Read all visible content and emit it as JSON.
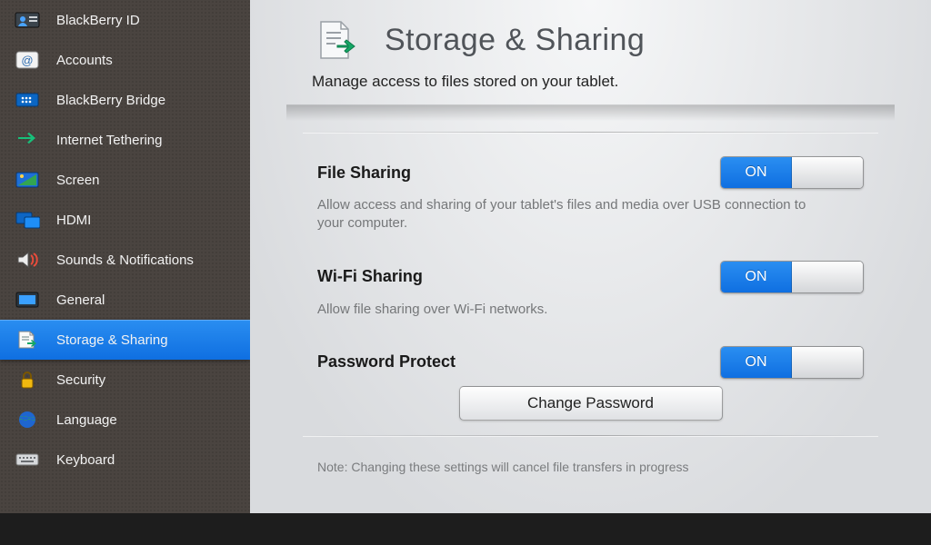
{
  "sidebar": {
    "items": [
      {
        "label": "BlackBerry ID",
        "icon": "bbid"
      },
      {
        "label": "Accounts",
        "icon": "at"
      },
      {
        "label": "BlackBerry Bridge",
        "icon": "bridge"
      },
      {
        "label": "Internet Tethering",
        "icon": "tether"
      },
      {
        "label": "Screen",
        "icon": "screen"
      },
      {
        "label": "HDMI",
        "icon": "hdmi"
      },
      {
        "label": "Sounds & Notifications",
        "icon": "sounds"
      },
      {
        "label": "General",
        "icon": "general"
      },
      {
        "label": "Storage & Sharing",
        "icon": "docarrow",
        "selected": true
      },
      {
        "label": "Security",
        "icon": "lock"
      },
      {
        "label": "Language",
        "icon": "globe"
      },
      {
        "label": "Keyboard",
        "icon": "keyboard"
      }
    ]
  },
  "page": {
    "title": "Storage & Sharing",
    "subtitle": "Manage access to files stored on your tablet.",
    "note": "Note: Changing these settings will cancel file transfers in progress"
  },
  "settings": {
    "file_sharing": {
      "title": "File Sharing",
      "desc": "Allow access and sharing of your tablet's files and media over USB connection to your computer.",
      "state_label": "ON"
    },
    "wifi_sharing": {
      "title": "Wi-Fi Sharing",
      "desc": "Allow file sharing over Wi-Fi networks.",
      "state_label": "ON"
    },
    "password_protect": {
      "title": "Password Protect",
      "state_label": "ON",
      "button": "Change Password"
    }
  }
}
